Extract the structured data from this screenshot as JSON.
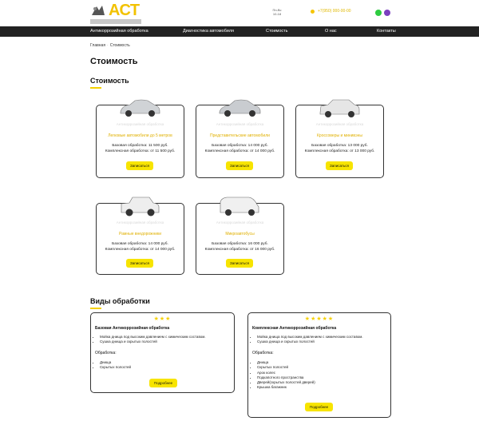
{
  "header": {
    "logo_text": "ACT",
    "hours": [
      "Пн-Вс",
      "10-18"
    ],
    "phone": "+7(950) 000-00-00"
  },
  "nav": [
    "Антикоррозийная обработка",
    "Диагностика автомобиля",
    "Стоимость",
    "О нас",
    "Контакты"
  ],
  "breadcrumb": {
    "home": "Главная",
    "current": "Стоимость"
  },
  "page_title": "Стоимость",
  "price_section_title": "Стоимость",
  "price_cards": [
    {
      "watermark": "Антикоррозийная обработка",
      "name": "Легковые автомобили до 5 метров",
      "basic_label": "Базовая обработка:",
      "basic_price": "11 500 руб.",
      "complex_label": "Комплексная обработка:",
      "complex_price": "от 11 500 руб.",
      "button": "Записаться",
      "car_color": "#d0d3d6"
    },
    {
      "watermark": "Антикоррозийная обработка",
      "name": "Представительские автомобили",
      "basic_label": "Базовая обработка:",
      "basic_price": "14 000 руб.",
      "complex_label": "Комплексная обработка:",
      "complex_price": "от 14 000 руб.",
      "button": "Записаться",
      "car_color": "#c9ccd0"
    },
    {
      "watermark": "Антикоррозийная обработка",
      "name": "Кроссоверы и минивэны",
      "basic_label": "Базовая обработка:",
      "basic_price": "13 000 руб.",
      "complex_label": "Комплексная обработка:",
      "complex_price": "от 13 000 руб.",
      "button": "Записаться",
      "car_color": "#e6e6e6"
    },
    {
      "watermark": "Антикоррозийная обработка",
      "name": "Рамные внедорожники",
      "basic_label": "Базовая обработка:",
      "basic_price": "14 000 руб.",
      "complex_label": "Комплексная обработка:",
      "complex_price": "от 14 000 руб.",
      "button": "Записаться",
      "car_color": "#eeeeee"
    },
    {
      "watermark": "Антикоррозийная обработка",
      "name": "Микроавтобусы",
      "basic_label": "Базовая обработка:",
      "basic_price": "16 000 руб.",
      "complex_label": "Комплексная обработка:",
      "complex_price": "от 16 000 руб.",
      "button": "Записаться",
      "car_color": "#f0f0f0"
    }
  ],
  "types_section_title": "Виды обработки",
  "treatments": [
    {
      "stars": "★★★",
      "title": "Базовая Антикоррозийная обработка",
      "items": [
        "Мойка днища под высоким давлением с химическим составом.",
        "Сушка днища и скрытых полостей"
      ],
      "processed_label": "Обработка:",
      "processed_items": [
        "Днища",
        "Скрытых полостей"
      ],
      "button": "Подробнее"
    },
    {
      "stars": "★★★★★",
      "title": "Комплексная Антикоррозийная обработка",
      "items": [
        "Мойка днища под высоким давлением с химическим составом.",
        "Сушка днища и скрытых полостей"
      ],
      "processed_label": "Обработка:",
      "processed_items": [
        "Днища",
        "Скрытых полостей",
        "Арок колес",
        "Подкапотного пространства",
        "Дверей(скрытых полостей дверей)",
        "Крышка багажник"
      ],
      "button": "Подробнее"
    }
  ],
  "colors": {
    "accent": "#f5d000",
    "button": "#f7e400",
    "nav_bg": "#222222"
  }
}
